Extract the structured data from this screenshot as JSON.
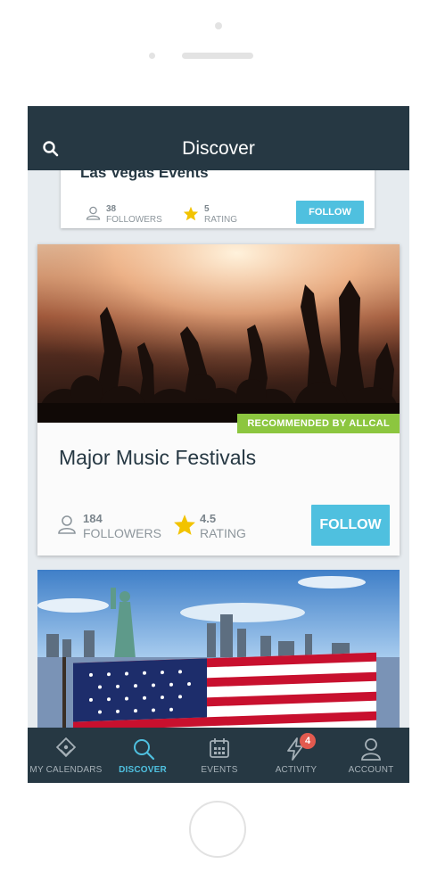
{
  "header": {
    "title": "Discover",
    "search_icon": "search-icon"
  },
  "cards": [
    {
      "name": "Las Vegas Events",
      "followers_count": "38",
      "followers_label": "FOLLOWERS",
      "rating_value": "5",
      "rating_label": "RATING",
      "follow_label": "FOLLOW"
    },
    {
      "badge": "RECOMMENDED BY ALLCAL",
      "name": "Major Music Festivals",
      "followers_count": "184",
      "followers_label": "FOLLOWERS",
      "rating_value": "4.5",
      "rating_label": "RATING",
      "follow_label": "FOLLOW"
    }
  ],
  "tabs": [
    {
      "label": "MY CALENDARS",
      "icon": "calendars-icon"
    },
    {
      "label": "DISCOVER",
      "icon": "search-icon",
      "active": true
    },
    {
      "label": "EVENTS",
      "icon": "calendar-icon"
    },
    {
      "label": "ACTIVITY",
      "icon": "lightning-icon",
      "badge": "4"
    },
    {
      "label": "ACCOUNT",
      "icon": "person-icon"
    }
  ],
  "colors": {
    "header_bg": "#263843",
    "accent": "#4fc0df",
    "badge_green": "#8cc63f",
    "notification_red": "#e25a4f",
    "star": "#f2c300"
  }
}
